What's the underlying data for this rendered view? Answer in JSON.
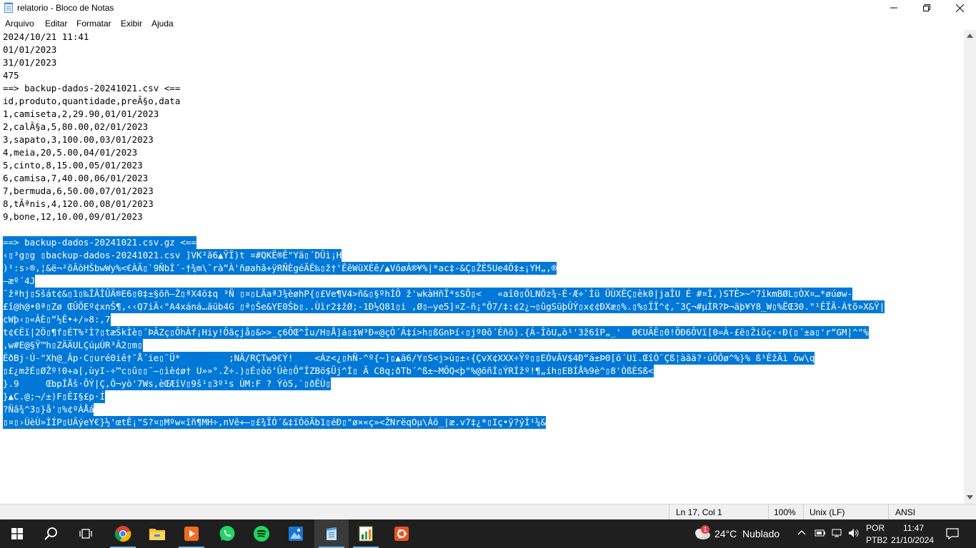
{
  "window": {
    "title": "relatorio - Bloco de Notas"
  },
  "menu": [
    "Arquivo",
    "Editar",
    "Formatar",
    "Exibir",
    "Ajuda"
  ],
  "editor": {
    "lines": [
      "2024/10/21 11:41",
      "01/01/2023",
      "31/01/2023",
      "475",
      "==> backup-dados-20241021.csv <==",
      "id,produto,quantidade,preÃ§o,data",
      "1,camiseta,2,29.90,01/01/2023",
      "2,calÃ§a,5,80.00,02/01/2023",
      "3,sapato,3,100.00,03/01/2023",
      "4,meia,20,5.00,04/01/2023",
      "5,cinto,8,15.00,05/01/2023",
      "6,camisa,7,40.00,06/01/2023",
      "7,bermuda,6,50.00,07/01/2023",
      "8,tÃªnis,4,120.00,08/01/2023",
      "9,bone,12,10.00,09/01/2023",
      ""
    ],
    "selected_lines": [
      "==> backup-dados-20241021.csv.gz <==",
      "‹▯³g▯g ▯backup-dados-20241021.csv ]VK²ã6▲ŸÏ)t ¤#QKË®Ê\"Yä▯´DÛì¡H",
      ")¹:s›®,¦&ë¬²õÂòHŠbwWy%<€ÀÃ▯`9ÑbÍ´-†¾m\\¯rà“À'ñøahâ+ÿRÑÈgéÄÊ‰▯ž†'ÊêWüXÉê/▲VõøÁ®¥%|*ac‡-&Ç▯ŽÈ5Ue4Ö‡±¡YH„,®",
      "–æº´4J",
      "¯žªhj▯Sšát¢&▯1▯‰ÎÂÎÛÄ®E6▯0‡±§õñ–Ž▯ªX4ö‡q ³Ñ ▯¤▯LÃaªJ¾èøhP{▯£Ve¶V4>ñ&▯§ºhÍÔ ž'wkàHñÏ*sSÕ▯<   «aî0▯ÖLNÕz¾-È·Æ÷`Ìü ÜÙXËÇ▯èk0|jaÎU É #¤Î,)STÈ>~^7îkmBØL▯ÒX¤…*øúøw-",
      "£î@h@•0ª▯Zø ŒÛÕEº¢xnŠ¶,‹‹Q7iÄ‹\"A4xáná…äüb4G ▯ª▯Še&YE0Šb▯..Ùìr2‡žØ;-1Ð½Q81▯i ,Ø▯–ye5]¤Z-ñ¡\"Õ7/‡:¢2¿¬▯ûgSüþÛÝ▯x¢¢ÐXæ▯%.▯%▯ÏÏ^¢,˜3Ç¬#µÍR?Þ¬äþ¥Y8_W▯%ËŒ30.\"¹ÊÏÄ-Àtõ»X&Ÿ|",
      "cWþ‹▯«ÂÈ▯“½Ê•+/»8:,7",
      "t¢€Ëï|2Ö▯¶f▯ÉT%²Ì?▯tæŠkÌè▯´ÞÂZç▯ÔhÀf¡Hiy!Ôãçjå▯&>>_ç6ÔŒ^Ìu/H▯Å]á▯‡W³Ð«@çÒ´Á‡í>h▯ßGnÞí‹▯jº0ô´Éñö).{Á-ÎòU„ò¹'3ž6îP„_'  Ø€UÄÊ▯0!ÖÐ6ÔVï[0=À-£ë▯Žiûç‹‹Ð(▯´±a▯'r“GM|^\"%",
      ",w#E@§Ÿ™h▯ZÄÄULÇúµÚR³Â2▯m▯",
      "ÉðBj·Ú-\"Xh@_Âp·C▯uré0iê†ˆÅ´ie▯¨Ü*         ;NÄ/RÇTw9€Ý!    <Áz<¿▯hÑ-^º{~]▯▲ä6/Y▯S<j>ù▯±‹{ÇvX¢XXX÷Ÿº▯▯EÒvÂV$4Ð“á±Þ0[õ´Uï.ŒîÒ¨Çß¦àãä?·úÕÕø^%}% ß¹ÊžÄì òw\\q",
      "▯£¿mžÉ▯Ø­Žº!0+a[,ùyI-÷™c▯û▯▯¨–▯ìè¢ø† U»»°.Ž÷.)▯É▯òö‘Ûè▯Ô”ÎZBö$Üj^Ì▯ Ä C8q;ðTb´^ß±~MÕQ<þ\"%@õñÍ▯ÝRÍžº!¶„íh▯EBÍÅ%9è^▯8'ÒßÈSß<",
      "}.9     ŒbpÎÅš·ÕÝ|Ç,Õ¬yò'7Ws,èŒÆîV▯9š¹▯3º¹s ÙM:F ? Ýò5,`▯ðËÙ▯",
      "}▲C.@;¬/±)F▯ÊI§£p·Í",
      "?Ñâ¾^3▯}å'▯%¢ºÀÅá",
      "▯¤▯›ÙèÙ»ÌÍP▯UÂýeY€}½'œtÊ¡\"S?¤▯Mºw«îñ¶MH÷,nVê+–▯£¾ÏÓ´&‡ïÓöÄb1▯éÐ▯\"ø×«ç»<ŽNrëqOµ\\Áõ_|æ.v7‡¿*▯Iç•ÿ?ýÌ¹¼&"
    ]
  },
  "status": {
    "position": "Ln 17, Col 1",
    "zoom": "100%",
    "line_ending": "Unix (LF)",
    "encoding": "ANSI"
  },
  "taskbar": {
    "weather_temp": "24°C",
    "weather_desc": "Nublado",
    "weather_badge": "1",
    "lang_top": "POR",
    "lang_bottom": "PTB2",
    "time": "11:47",
    "date": "21/10/2024",
    "apps": [
      "chrome-icon",
      "file-explorer-icon",
      "media-player-icon",
      "whatsapp-icon",
      "spotify-icon",
      "photos-icon",
      "notepad-icon",
      "spreadsheet-icon",
      "ubuntu-icon"
    ]
  },
  "colors": {
    "selection": "#0078d7",
    "taskbar": "#1f1f1f",
    "statusbar": "#f0f0f0"
  }
}
